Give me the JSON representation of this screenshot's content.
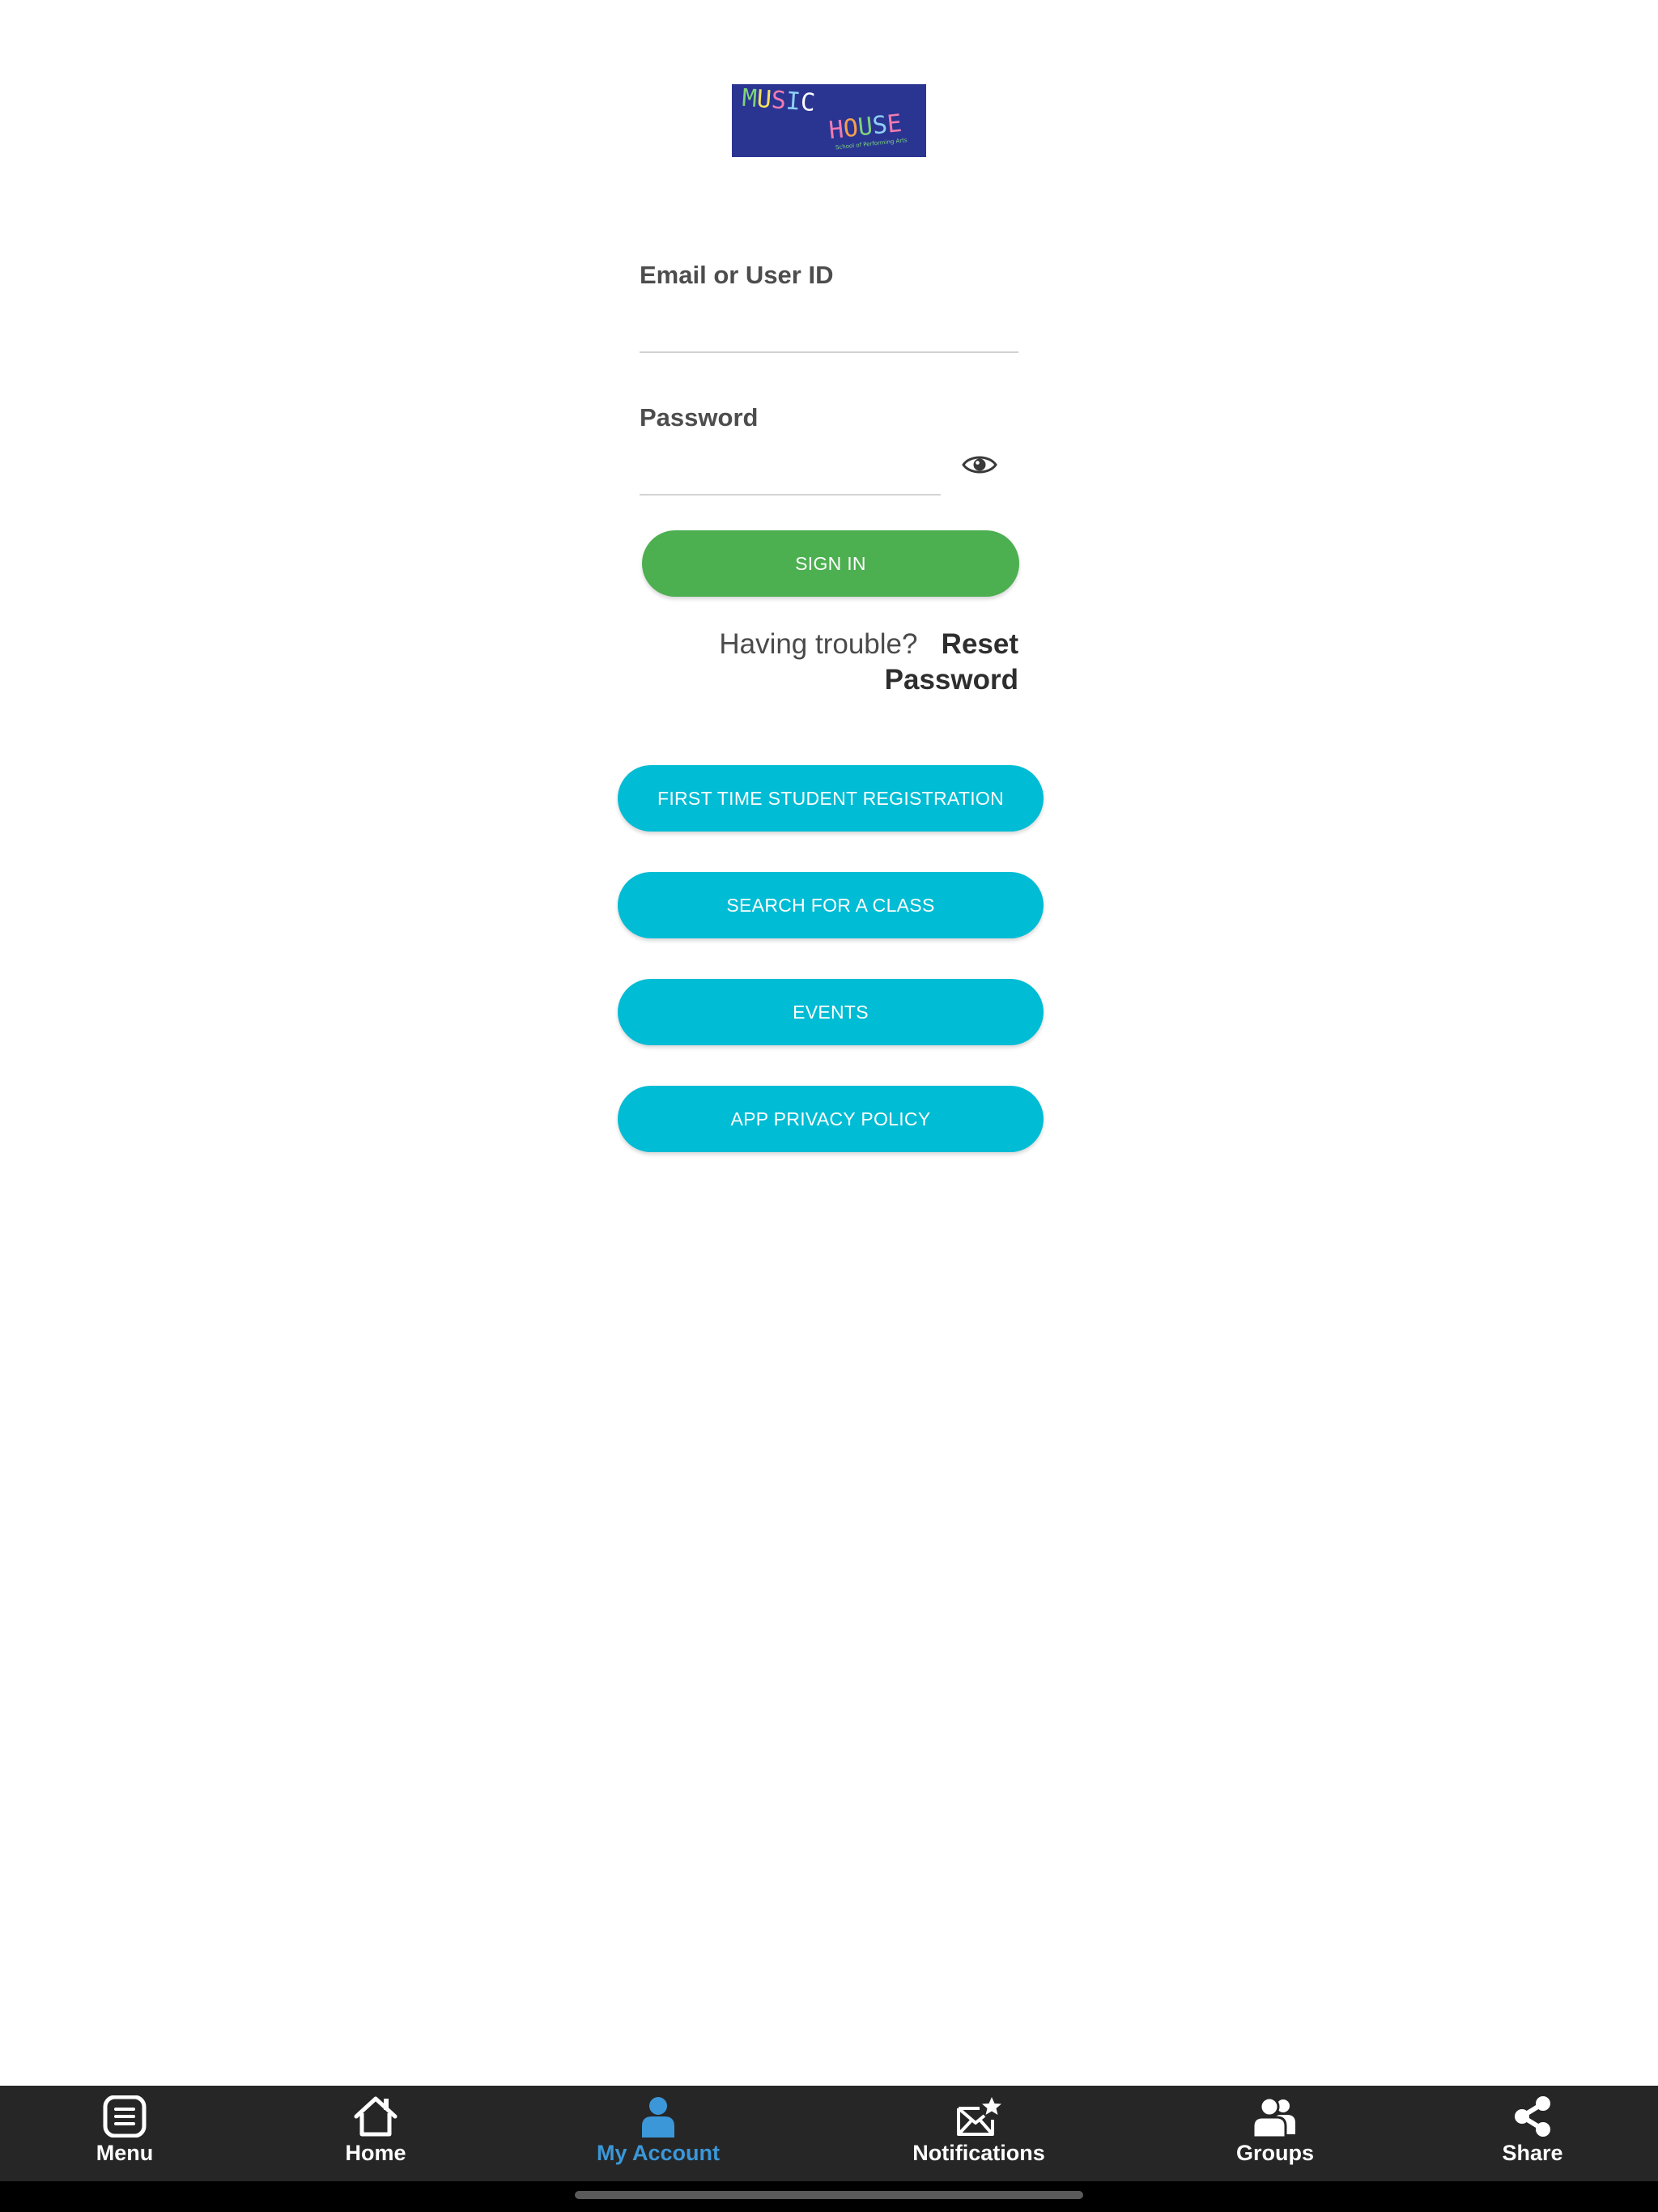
{
  "logo": {
    "line1": "MUSIC",
    "line2": "HOUSE",
    "tagline": "School of Performing Arts",
    "background": "#2a3592"
  },
  "form": {
    "email_label": "Email or User ID",
    "email_value": "",
    "password_label": "Password",
    "password_value": "",
    "show_password_icon": "eye-icon",
    "sign_in": "SIGN IN",
    "trouble_text": "Having trouble?",
    "reset_link": "Reset Password"
  },
  "actions": {
    "registration": "FIRST TIME STUDENT REGISTRATION",
    "search_class": "SEARCH FOR A CLASS",
    "events": "EVENTS",
    "privacy": "APP PRIVACY POLICY"
  },
  "tabs": {
    "menu": "Menu",
    "home": "Home",
    "account": "My Account",
    "notifications": "Notifications",
    "groups": "Groups",
    "share": "Share",
    "active": "account"
  },
  "colors": {
    "sign_in": "#4caf50",
    "action_buttons": "#00bcd4",
    "tabbar": "#262626",
    "active_tab": "#3b97d8"
  }
}
